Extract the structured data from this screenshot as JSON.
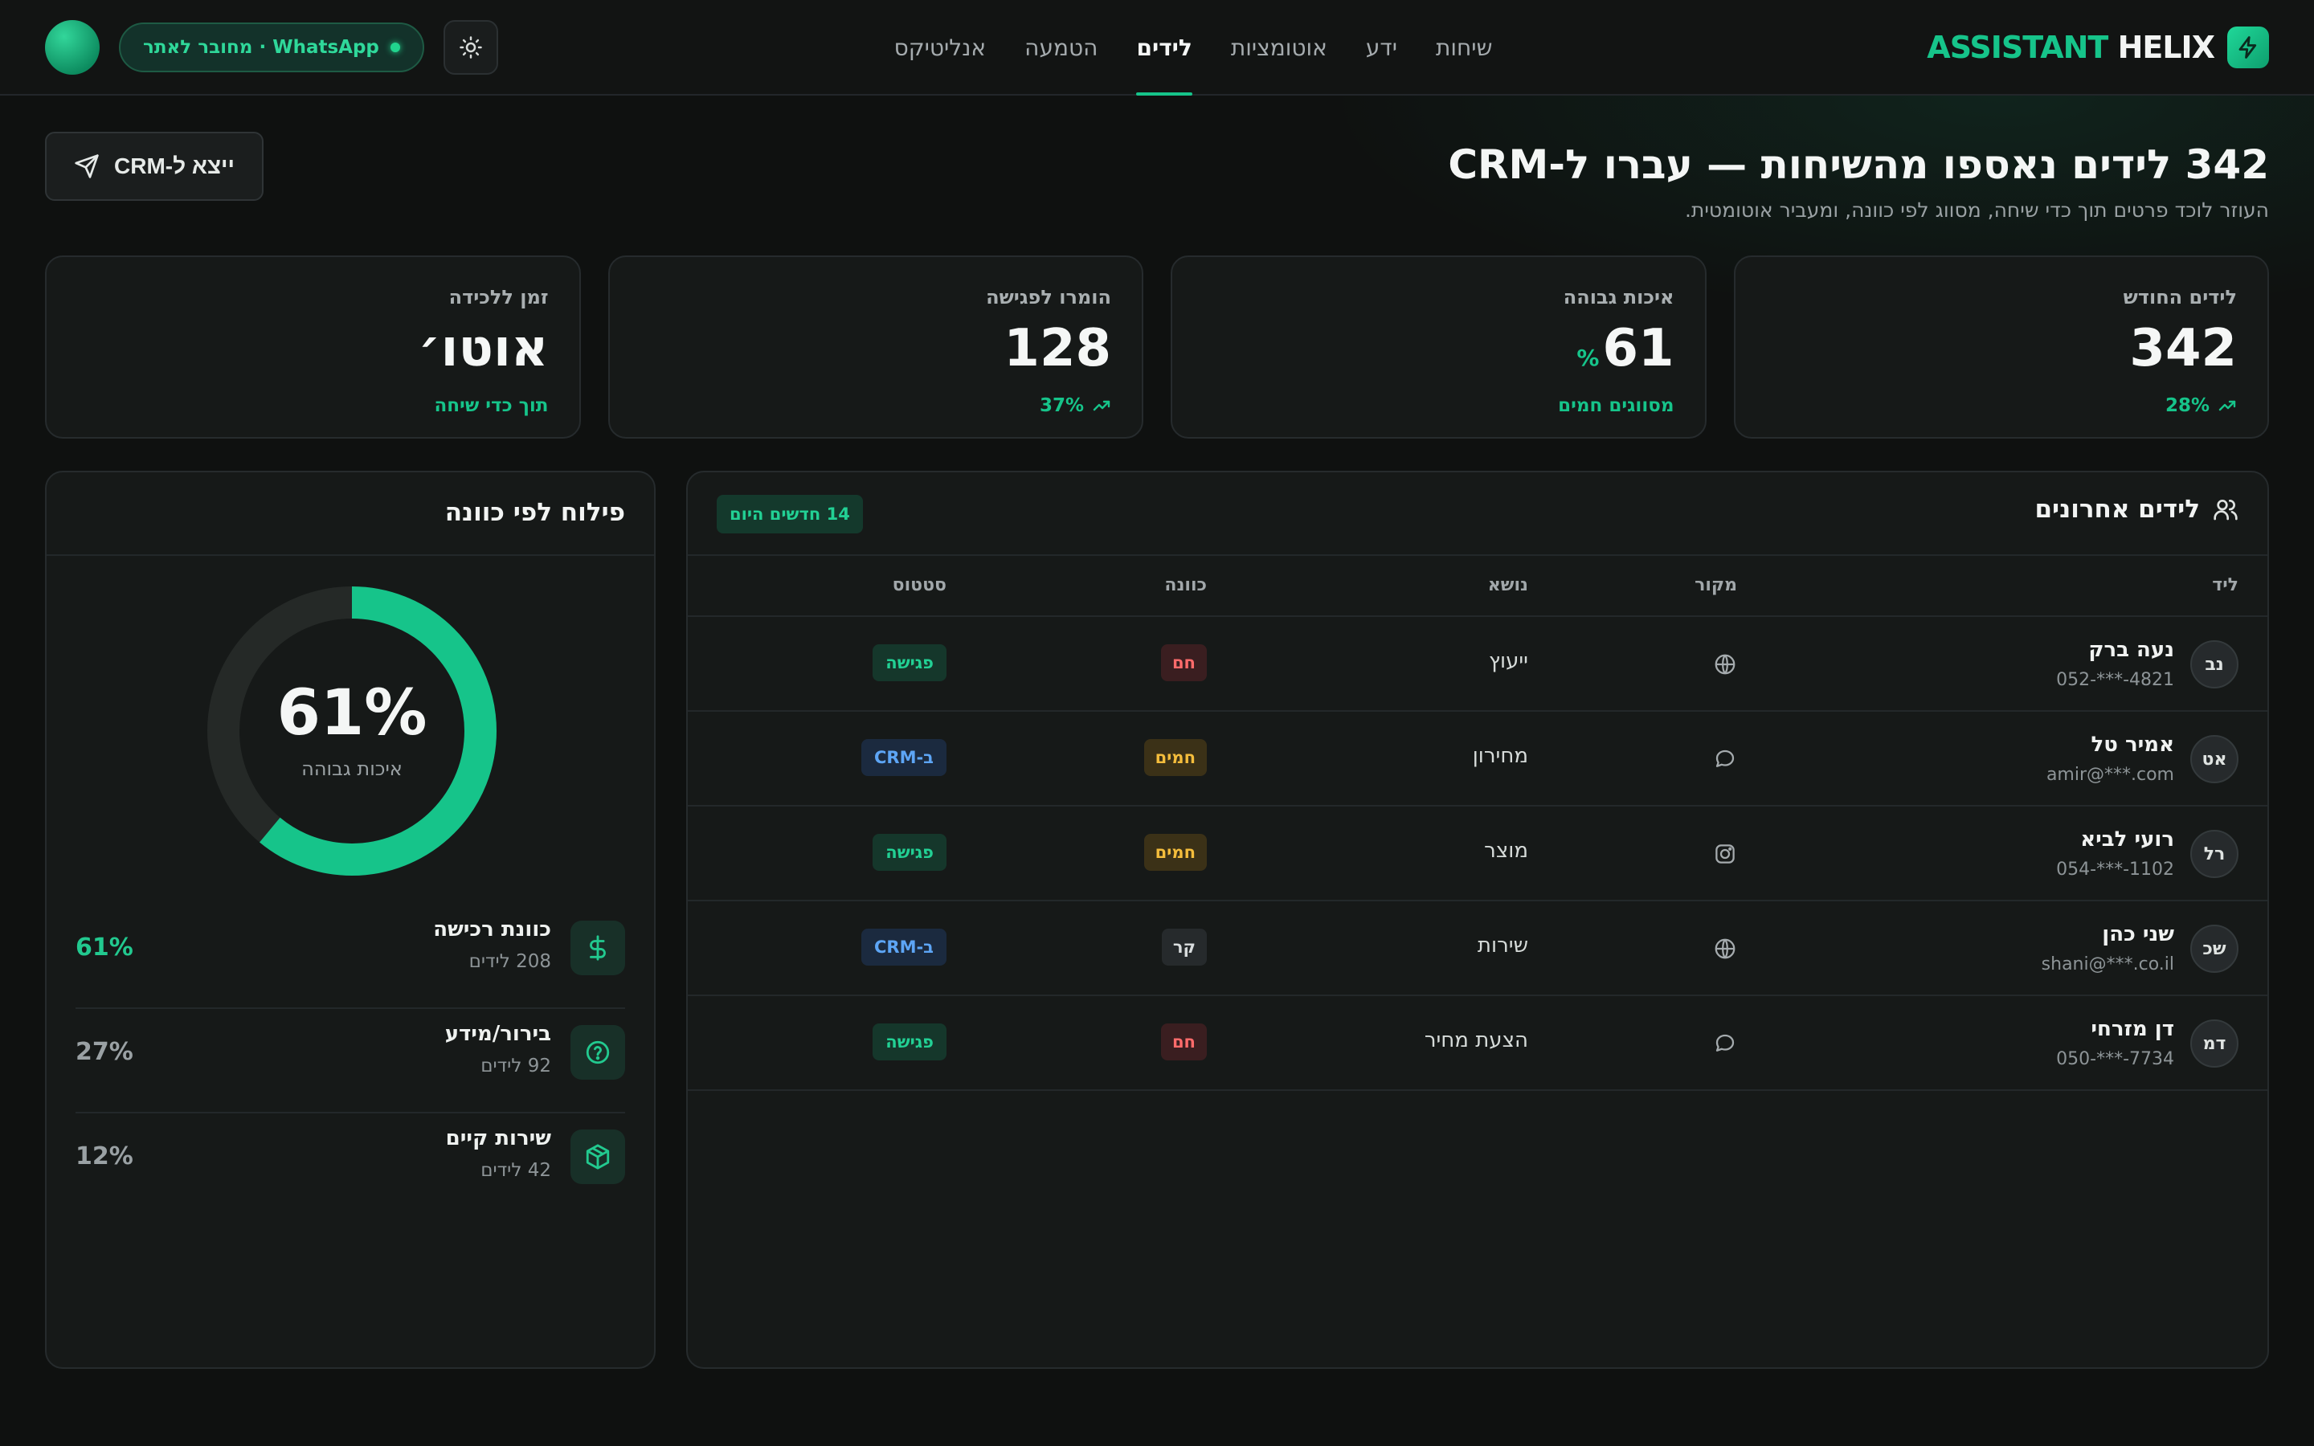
{
  "brand": {
    "name_part1": "HELIX",
    "name_part2": "ASSISTANT"
  },
  "nav": [
    {
      "label": "שיחות"
    },
    {
      "label": "ידע"
    },
    {
      "label": "אוטומציות"
    },
    {
      "label": "לידים"
    },
    {
      "label": "הטמעה"
    },
    {
      "label": "אנליטיקס"
    }
  ],
  "nav_active": "לידים",
  "connection": {
    "label": "WhatsApp · מחובר לאתר"
  },
  "hero": {
    "title": "342 לידים נאספו מהשיחות — עברו ל-CRM",
    "subtitle": "העוזר לוכד פרטים תוך כדי שיחה, מסווג לפי כוונה, ומעביר אוטומטית.",
    "export_label": "ייצא ל-CRM"
  },
  "kpis": [
    {
      "label": "לידים החודש",
      "value": "342",
      "suffix": "",
      "foot": "28%",
      "icon": "trend-up-icon"
    },
    {
      "label": "איכות גבוהה",
      "value": "61",
      "suffix": "%",
      "foot": "מסווגים חמים",
      "icon": ""
    },
    {
      "label": "הומרו לפגישה",
      "value": "128",
      "suffix": "",
      "foot": "37%",
      "icon": "trend-up-icon"
    },
    {
      "label": "זמן ללכידה",
      "value": "אוטו׳",
      "suffix": "",
      "foot": "תוך כדי שיחה",
      "icon": ""
    }
  ],
  "leads": {
    "title": "לידים אחרונים",
    "today_badge": "14 חדשים היום",
    "columns": {
      "lead": "ליד",
      "source": "מקור",
      "topic": "נושא",
      "intent": "כוונה",
      "status": "סטטוס"
    },
    "rows": [
      {
        "initials": "נב",
        "name": "נעה ברק",
        "contact": "052-***-4821",
        "source": "globe-icon",
        "topic": "ייעוץ",
        "intent": "חם",
        "intent_level": "hot",
        "status": "פגישה",
        "status_kind": "meet"
      },
      {
        "initials": "אט",
        "name": "אמיר טל",
        "contact": "amir@***.com",
        "source": "chat-icon",
        "topic": "מחירון",
        "intent": "חמים",
        "intent_level": "warm",
        "status": "ב-CRM",
        "status_kind": "crm"
      },
      {
        "initials": "רל",
        "name": "רועי לביא",
        "contact": "054-***-1102",
        "source": "instagram-icon",
        "topic": "מוצר",
        "intent": "חמים",
        "intent_level": "warm",
        "status": "פגישה",
        "status_kind": "meet"
      },
      {
        "initials": "שכ",
        "name": "שני כהן",
        "contact": "shani@***.co.il",
        "source": "globe-icon",
        "topic": "שירות",
        "intent": "קר",
        "intent_level": "cold",
        "status": "ב-CRM",
        "status_kind": "crm"
      },
      {
        "initials": "דמ",
        "name": "דן מזרחי",
        "contact": "050-***-7734",
        "source": "chat-icon",
        "topic": "הצעת מחיר",
        "intent": "חם",
        "intent_level": "hot",
        "status": "פגישה",
        "status_kind": "meet"
      }
    ]
  },
  "intent_breakdown": {
    "title": "פילוח לפי כוונה",
    "donut_value": "61%",
    "donut_fraction": 0.61,
    "donut_caption": "איכות גבוהה",
    "items": [
      {
        "name": "כוונת רכישה",
        "count": "208 לידים",
        "pct": "61%",
        "icon": "dollar-icon",
        "color": "#22c98f"
      },
      {
        "name": "בירור/מידע",
        "count": "92 לידים",
        "pct": "27%",
        "icon": "question-icon",
        "color": "#9aa1a4"
      },
      {
        "name": "שירות קיים",
        "count": "42 לידים",
        "pct": "12%",
        "icon": "box-icon",
        "color": "#9aa1a4"
      }
    ]
  },
  "colors": {
    "accent": "#16c48a",
    "background": "#0f1110",
    "card": "#161918"
  }
}
